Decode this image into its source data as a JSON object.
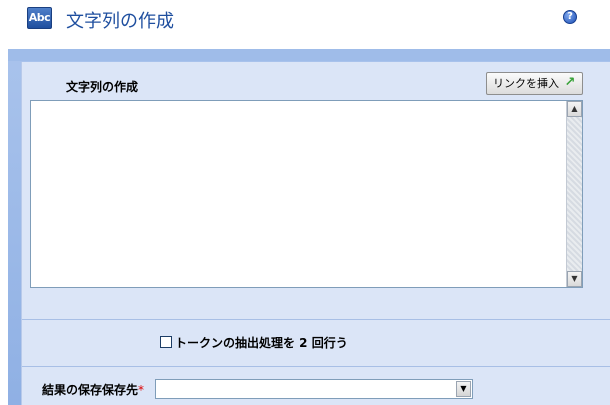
{
  "header": {
    "icon_text": "Abc",
    "title": "文字列の作成",
    "help_icon": "?"
  },
  "section": {
    "label": "文字列の作成",
    "insert_link_label": "リンクを挿入",
    "insert_link_icon": "↗"
  },
  "textarea": {
    "value": "",
    "scroll_up": "▲",
    "scroll_down": "▼"
  },
  "options": {
    "token_checkbox_label": "トークンの抽出処理を 2 回行う",
    "token_checkbox_checked": false
  },
  "result": {
    "label": "結果の保存保存先",
    "required_marker": "*",
    "selected_value": "",
    "dropdown_arrow": "▼"
  },
  "colors": {
    "title": "#1f4f9f",
    "panel_bg": "#dbe5f7",
    "frame_bg": "#9fbce9",
    "required": "#dd0000"
  }
}
